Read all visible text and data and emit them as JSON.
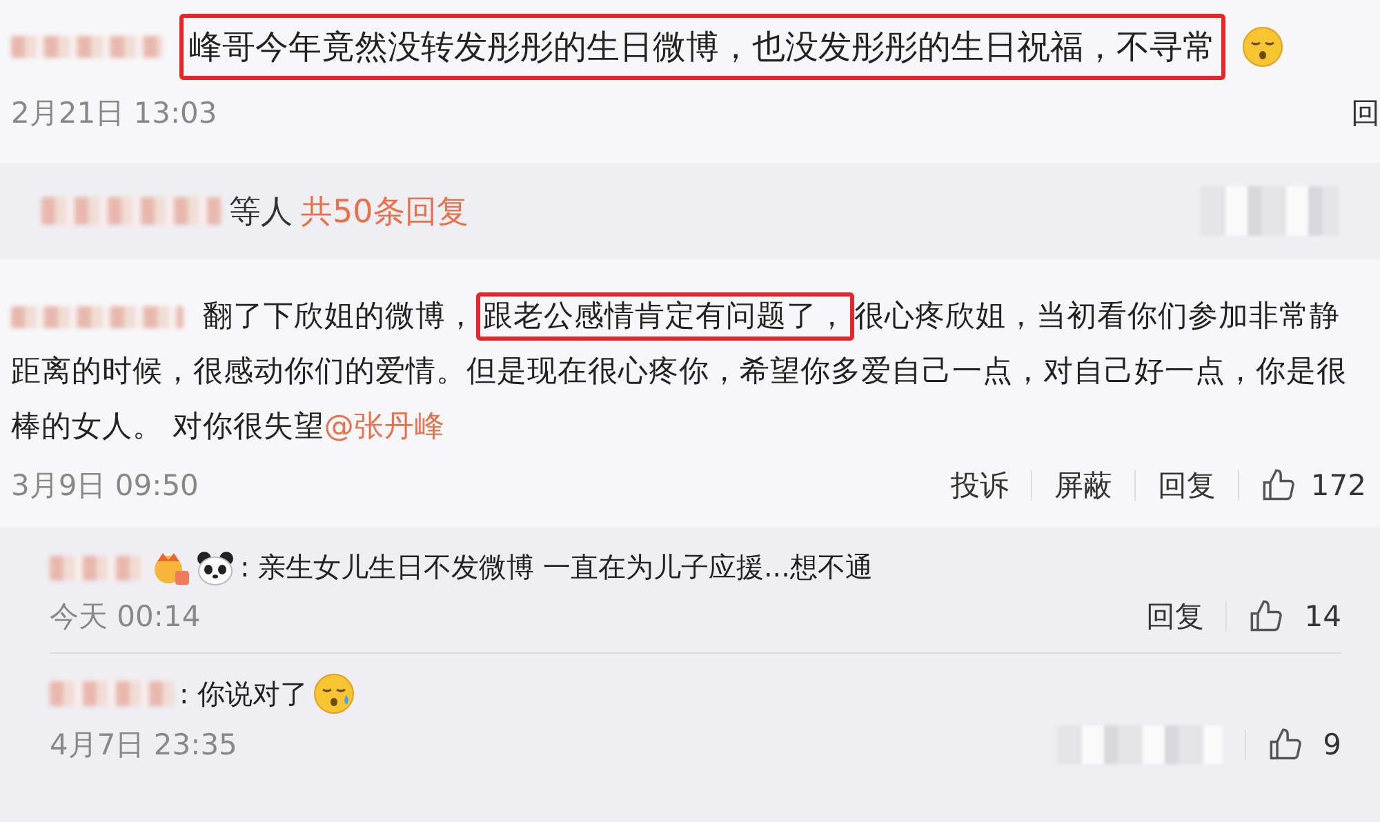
{
  "comment": {
    "text": "峰哥今年竟然没转发彤彤的生日微博，也没发彤彤的生日祝福，不寻常",
    "highlighted": true,
    "time": "2月21日 13:03",
    "reply_label": "回"
  },
  "reply_summary": {
    "suffix": "等人",
    "count": "共50条回复"
  },
  "reply": {
    "text_before": "翻了下欣姐的微博，",
    "highlight": "跟老公感情肯定有问题了，",
    "text_after": "很心疼欣姐，当初看你们参加非常静距离的时候，很感动你们的爱情。但是现在很心疼你，希望你多爱自己一点，对自己好一点，你是很棒的女人。 对你很失望",
    "mention": "@张丹峰",
    "time": "3月9日 09:50",
    "actions": [
      "投诉",
      "屏蔽",
      "回复"
    ],
    "likes": "172"
  },
  "sub_replies": [
    {
      "text": ": 亲生女儿生日不发微博 一直在为儿子应援...想不通",
      "time": "今天 00:14",
      "reply_label": "回复",
      "likes": "14",
      "kind": "badged"
    },
    {
      "text": ": 你说对了",
      "time": "4月7日 23:35",
      "likes": "9",
      "kind": "emoji"
    }
  ]
}
